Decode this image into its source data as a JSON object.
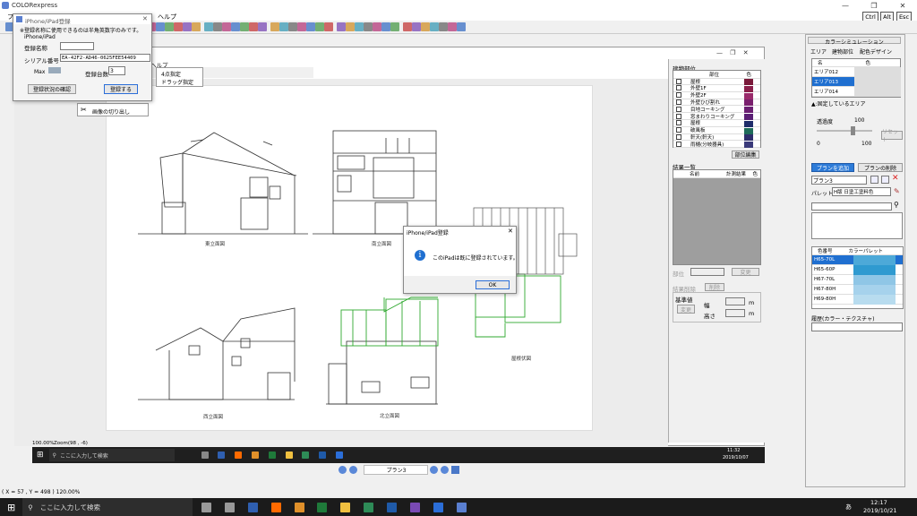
{
  "app": {
    "title": "COLORexpress",
    "window_buttons": [
      "—",
      "❐",
      "✕"
    ]
  },
  "menu": {
    "first": "フ",
    "help": "ヘルプ"
  },
  "keys": [
    "Ctrl",
    "Alt",
    "Esc"
  ],
  "iphone_dialog": {
    "title": "iPhone/iPad登録",
    "note": "※登録名称に使用できるのは半角英数字のみです。",
    "group": "iPhone/iPad",
    "name_label": "登録名称",
    "name_value": "",
    "serial_label": "シリアル番号",
    "serial_value": "EA-42F2-AD46-0625FEE54409",
    "max_label": "Max",
    "count_label": "登録台数",
    "count_value": "3",
    "check_button": "登録状況の確認",
    "register_button": "登録する"
  },
  "context_menu": {
    "items": [
      "4点指定",
      "ドラッグ指定"
    ],
    "item_crop": "画像の切り出し",
    "help_fragment": "ヘルプ"
  },
  "drawings": {
    "east": "東立面図",
    "south": "南立面図",
    "west": "西立面図",
    "north": "北立面図",
    "roof": "屋根伏図"
  },
  "message_box": {
    "title": "iPhone/iPad登録",
    "message": "このiPadは既に登録されています。",
    "ok": "OK",
    "close": "✕"
  },
  "parts_panel": {
    "title": "建物部位",
    "col_part": "部位",
    "col_color": "色",
    "items": [
      {
        "label": "屋根",
        "color": "#7a1a3a"
      },
      {
        "label": "外壁1F",
        "color": "#8a1f4a"
      },
      {
        "label": "外壁2F",
        "color": "#992a6a"
      },
      {
        "label": "外壁ひび割れ",
        "color": "#7a1f6e"
      },
      {
        "label": "目地コーキング",
        "color": "#6b1f72"
      },
      {
        "label": "窓まわりコーキング",
        "color": "#5a1f74"
      },
      {
        "label": "屋根",
        "color": "#1f2d6b"
      },
      {
        "label": "破風板",
        "color": "#1f6b5a"
      },
      {
        "label": "軒天(軒天)",
        "color": "#2d2d6b"
      },
      {
        "label": "雨樋(分岐器具)",
        "color": "#3a3a7a"
      }
    ],
    "edit_button": "部位編集",
    "results_title": "結果一覧",
    "col_name": "名前",
    "col_result": "計測結果",
    "col_color2": "色",
    "part_label": "部位",
    "change_button": "変更",
    "delete_label": "結果削除",
    "delete_button": "削除",
    "base_title": "基準値",
    "base_button": "変更",
    "width_label": "幅",
    "height_label": "高さ",
    "unit": "m"
  },
  "color_sim": {
    "title": "カラーシミュレーション",
    "tabs": [
      "エリア",
      "建物部位",
      "配色デザイン"
    ],
    "col_name": "名",
    "col_color": "色",
    "areas": [
      "エリア012",
      "エリア013",
      "エリア014"
    ],
    "fixed_note": "▲:固定しているエリア",
    "transparency_label": "透過度",
    "transparency_value": "100",
    "slider_min": "0",
    "slider_max": "100",
    "transparency_fraction": 0.65,
    "reset_button": "リセット",
    "add_plan": "プランを追加",
    "delete_plan": "プランの削除",
    "plan_value": "プラン3",
    "palette_label": "パレット",
    "palette_select": "H版 日塗工塗料色",
    "col_colorno": "色番号",
    "col_palette": "カラーパレット",
    "colors": [
      {
        "no": "H65-70L",
        "hex": "#4da9d8"
      },
      {
        "no": "H65-60P",
        "hex": "#2f9ad0"
      },
      {
        "no": "H67-70L",
        "hex": "#8fc6e6"
      },
      {
        "no": "H67-80H",
        "hex": "#a6d2ec"
      },
      {
        "no": "H69-80H",
        "hex": "#b8dcef"
      }
    ],
    "history_label": "履歴(カラー・テクスチャ)"
  },
  "status": {
    "zoom": "100.00%",
    "zoom_coord": "Zoom(98 , -6)",
    "coords": "( X = 57 , Y = 498 ) 120.00%"
  },
  "bottom_nav": {
    "plan": "プラン3"
  },
  "inner_taskbar": {
    "search": "ここに入力して検索",
    "time": "11:32",
    "date": "2019/10/07"
  },
  "taskbar": {
    "search": "ここに入力して検索",
    "time": "12:17",
    "date": "2019/10/21",
    "lang": "あ"
  }
}
